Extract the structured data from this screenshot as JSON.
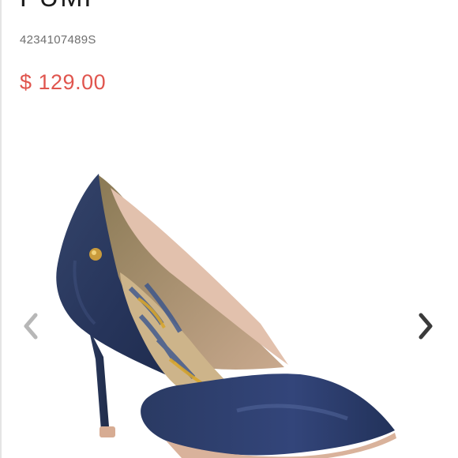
{
  "product": {
    "title": "PUMP",
    "sku": "4234107489S",
    "price": "$ 129.00"
  },
  "gallery": {
    "image_subject": "navy blue pointed-toe pump",
    "prev_icon": "chevron-left-icon",
    "next_icon": "chevron-right-icon"
  },
  "colors": {
    "price": "#e0554e",
    "shoe_body": "#2b3a5e",
    "arrow_prev": "#b7b7b7",
    "arrow_next": "#3a3a3a"
  }
}
